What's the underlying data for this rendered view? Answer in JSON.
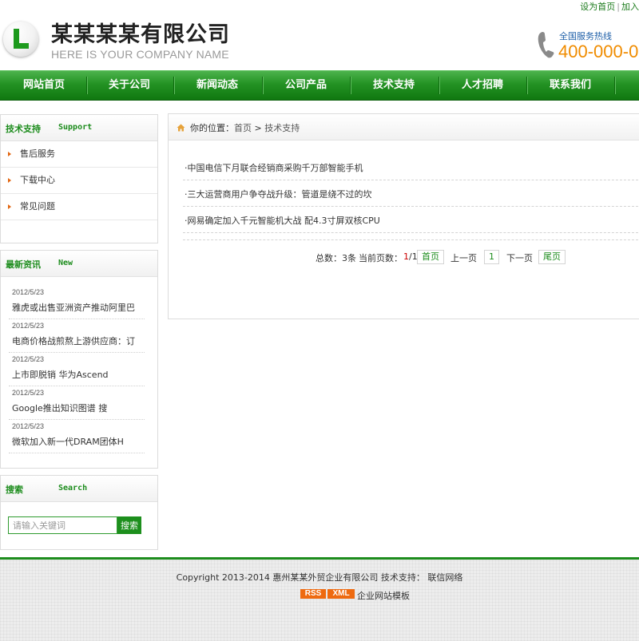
{
  "toplinks": {
    "set_home": "设为首页",
    "separator": "|",
    "add_fav": "加入"
  },
  "header": {
    "company_name": "某某某某有限公司",
    "company_en": "HERE IS YOUR COMPANY NAME",
    "hotline_label": "全国服务热线",
    "hotline_number": "400-000-0"
  },
  "nav": {
    "items": [
      "网站首页",
      "关于公司",
      "新闻动态",
      "公司产品",
      "技术支持",
      "人才招聘",
      "联系我们"
    ]
  },
  "sidebar": {
    "support": {
      "title": "技术支持",
      "title_en": "Support",
      "items": [
        "售后服务",
        "下载中心",
        "常见问题"
      ]
    },
    "news": {
      "title": "最新资讯",
      "title_en": "New",
      "items": [
        {
          "date": "2012/5/23",
          "title": "雅虎或出售亚洲资产推动阿里巴"
        },
        {
          "date": "2012/5/23",
          "title": "电商价格战煎熬上游供应商：订"
        },
        {
          "date": "2012/5/23",
          "title": "上市即脱销 华为Ascend"
        },
        {
          "date": "2012/5/23",
          "title": "Google推出知识图谱 搜"
        },
        {
          "date": "2012/5/23",
          "title": "微软加入新一代DRAM团体H"
        }
      ]
    },
    "search": {
      "title": "搜索",
      "title_en": "Search",
      "placeholder": "请输入关键词",
      "button": "搜索"
    }
  },
  "main": {
    "breadcrumb": {
      "label": "你的位置：",
      "home": "首页",
      "separator": ">",
      "current": "技术支持"
    },
    "articles": [
      "·中国电信下月联合经销商采购千万部智能手机",
      "·三大运营商用户争夺战升级：管道是绕不过的坎",
      "·网易确定加入千元智能机大战 配4.3寸屏双核CPU"
    ],
    "pager": {
      "total": "总数：3条",
      "current_label": "当前页数：",
      "current": "1",
      "of": "/1",
      "first": "首页",
      "prev": "上一页",
      "page": "1",
      "next": "下一页",
      "last": "尾页"
    }
  },
  "footer": {
    "copyright": "Copyright 2013-2014 惠州某某外贸企业有限公司 技术支持： 联信网络",
    "rss": "RSS",
    "xml": "XML",
    "template": "企业网站模板"
  },
  "colors": {
    "brand_green": "#1c8c1c",
    "hotline_orange": "#f08c00",
    "badge_orange": "#ee6a10"
  }
}
